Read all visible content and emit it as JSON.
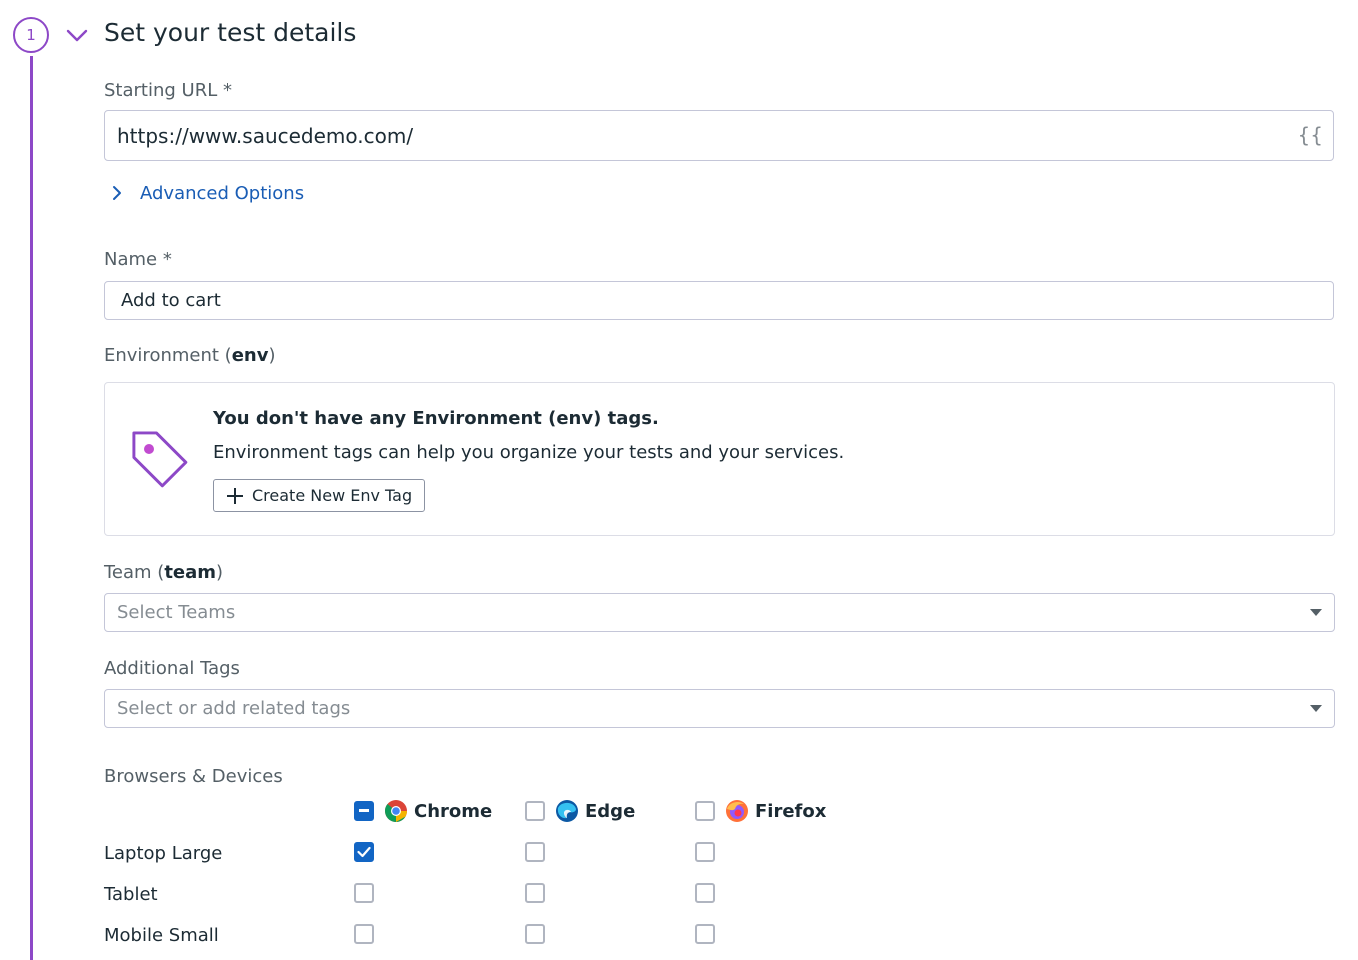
{
  "step": {
    "number": "1",
    "title": "Set your test details"
  },
  "starting_url": {
    "label": "Starting URL *",
    "value": "https://www.saucedemo.com/",
    "variable_icon": "{{"
  },
  "advanced_options": {
    "label": "Advanced Options"
  },
  "name_field": {
    "label": "Name *",
    "value": "Add to cart"
  },
  "environment": {
    "label_prefix": "Environment (",
    "label_key": "env",
    "label_suffix": ")",
    "empty_title": "You don't have any Environment (env) tags.",
    "empty_description": "Environment tags can help you organize your tests and your services.",
    "create_button": "Create New Env Tag"
  },
  "team": {
    "label_prefix": "Team (",
    "label_key": "team",
    "label_suffix": ")",
    "placeholder": "Select Teams"
  },
  "additional_tags": {
    "label": "Additional Tags",
    "placeholder": "Select or add related tags"
  },
  "browsers_devices": {
    "label": "Browsers & Devices",
    "browsers": [
      {
        "name": "Chrome",
        "icon": "chrome-icon",
        "state": "partial"
      },
      {
        "name": "Edge",
        "icon": "edge-icon",
        "state": "unchecked"
      },
      {
        "name": "Firefox",
        "icon": "firefox-icon",
        "state": "unchecked"
      }
    ],
    "devices": [
      {
        "name": "Laptop Large",
        "checks": [
          true,
          false,
          false
        ]
      },
      {
        "name": "Tablet",
        "checks": [
          false,
          false,
          false
        ]
      },
      {
        "name": "Mobile Small",
        "checks": [
          false,
          false,
          false
        ]
      }
    ]
  },
  "colors": {
    "accent_purple": "#8d48c7",
    "link_blue": "#1a5db5",
    "checkbox_blue": "#1265c4"
  }
}
